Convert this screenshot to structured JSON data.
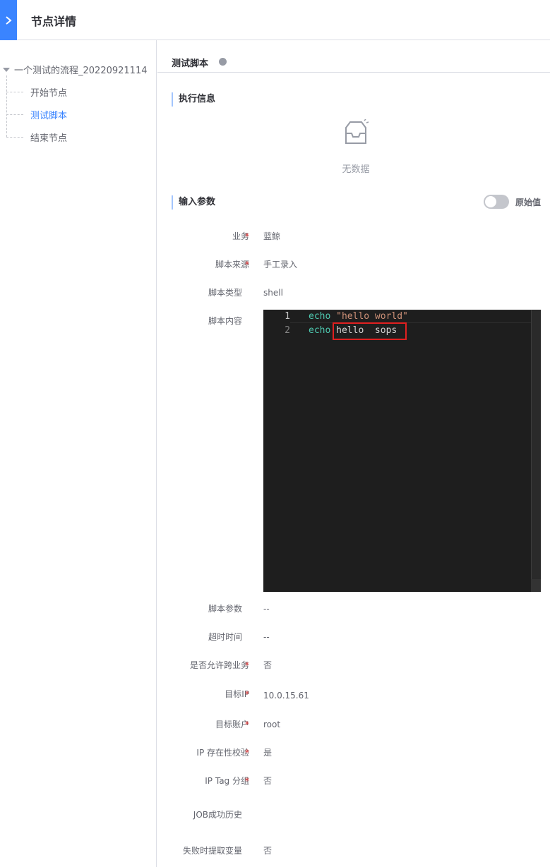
{
  "header": {
    "title": "节点详情"
  },
  "tree": {
    "root_label": "一个测试的流程_20220921114",
    "nodes": [
      {
        "label": "开始节点",
        "active": false
      },
      {
        "label": "测试脚本",
        "active": true
      },
      {
        "label": "结束节点",
        "active": false
      }
    ]
  },
  "node": {
    "title": "测试脚本"
  },
  "exec_info": {
    "title": "执行信息",
    "empty_text": "无数据"
  },
  "input_params": {
    "title": "输入参数",
    "toggle_label": "原始值",
    "toggle_on": false,
    "fields": [
      {
        "label": "业务",
        "required": true,
        "value": "蓝鲸"
      },
      {
        "label": "脚本来源",
        "required": true,
        "value": "手工录入"
      },
      {
        "label": "脚本类型",
        "required": false,
        "value": "shell"
      },
      {
        "label": "脚本内容",
        "required": false,
        "value": ""
      },
      {
        "label": "脚本参数",
        "required": false,
        "value": "--"
      },
      {
        "label": "超时时间",
        "required": false,
        "value": "--"
      },
      {
        "label": "是否允许跨业务",
        "required": true,
        "value": "否"
      },
      {
        "label": "目标IP",
        "required": true,
        "value": "10.0.15.61"
      },
      {
        "label": "目标账户",
        "required": true,
        "value": "root"
      },
      {
        "label": "IP 存在性校验",
        "required": true,
        "value": "是"
      },
      {
        "label": "IP Tag 分组",
        "required": true,
        "value": "否"
      },
      {
        "label": "JOB成功历史",
        "required": false,
        "value": ""
      },
      {
        "label": "失败时提取变量",
        "required": false,
        "value": "否"
      }
    ]
  },
  "editor": {
    "lines": [
      {
        "no": "1",
        "keyword": "echo",
        "rest": " \"hello world\"",
        "rest_type": "string"
      },
      {
        "no": "2",
        "keyword": "echo",
        "rest": " hello  sops",
        "rest_type": "plain"
      }
    ]
  },
  "colors": {
    "accent": "#3a84ff",
    "required": "#ea3636",
    "highlight": "#e02020",
    "editor_bg": "#1e1e1e"
  }
}
